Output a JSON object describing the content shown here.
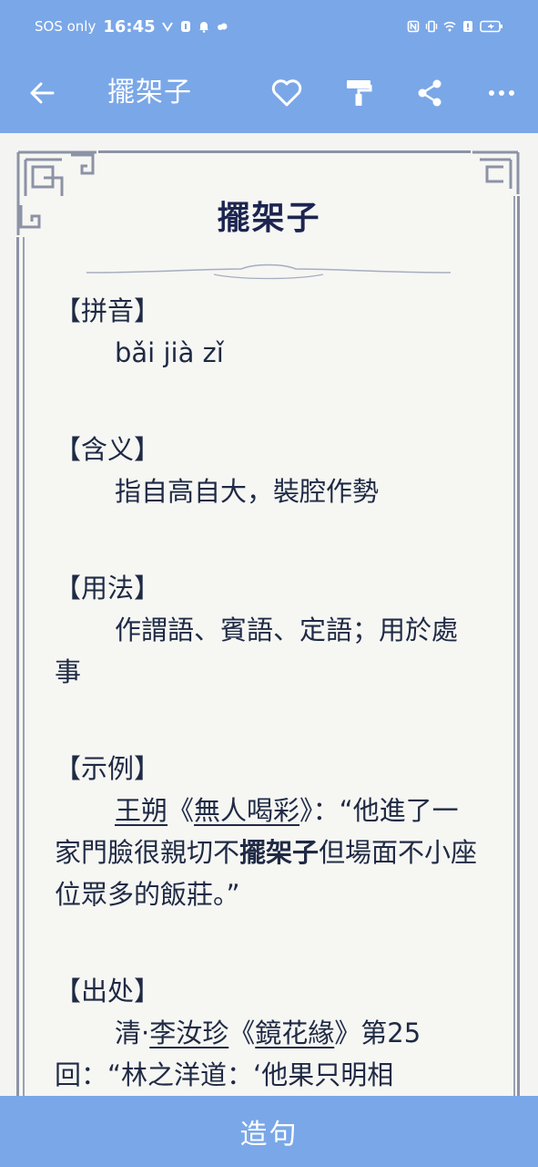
{
  "status": {
    "left_text": "SOS only",
    "time": "16:45",
    "icons_left": [
      "gecko-icon",
      "shield-icon",
      "bell-icon",
      "cloud-icon"
    ],
    "icons_right": [
      "nfc-icon",
      "vibrate-icon",
      "wifi-icon",
      "alert-icon",
      "battery-icon"
    ]
  },
  "appbar": {
    "title": "擺架子",
    "actions": [
      "heart-icon",
      "paint-roller-icon",
      "share-icon",
      "more-icon"
    ]
  },
  "entry": {
    "word": "擺架子",
    "sections": {
      "pinyin": {
        "head": "【拼音】",
        "body": "bǎi jià zǐ"
      },
      "meaning": {
        "head": "【含义】",
        "body": "指自高自大，裝腔作勢"
      },
      "usage": {
        "head": "【用法】",
        "body": "作謂語、賓語、定語；用於處事"
      },
      "example": {
        "head": "【示例】",
        "author": "王朔",
        "book_open": "《",
        "book": "無人喝彩",
        "book_close": "》",
        "text_1": "：“他進了一家門臉很親切不",
        "highlight": "擺架子",
        "text_2": "但場面不小座位眾多的飯莊。”"
      },
      "source": {
        "head": "【出处】",
        "dynasty": "清·",
        "author": "李汝珍",
        "book_open": "《",
        "book": "鏡花緣",
        "book_close": "》",
        "text_1": "第25回：“林之洋道：‘他果只明相"
      }
    }
  },
  "bottom": {
    "button": "造句"
  }
}
